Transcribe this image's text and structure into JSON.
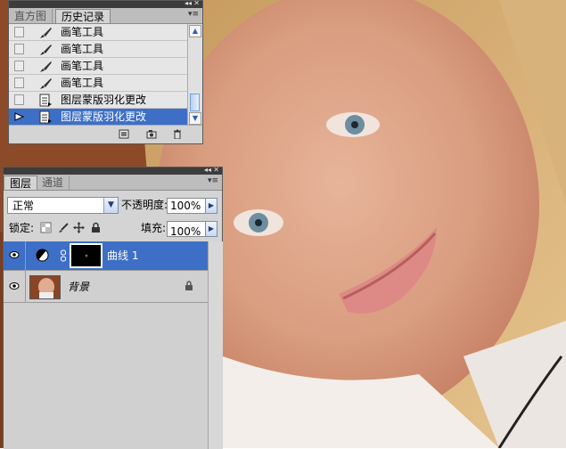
{
  "history_panel": {
    "tabs": [
      "直方图",
      "历史记录"
    ],
    "active_tab": "历史记录",
    "items": [
      {
        "label": "画笔工具",
        "icon": "brush-icon",
        "selected": false
      },
      {
        "label": "画笔工具",
        "icon": "brush-icon",
        "selected": false
      },
      {
        "label": "画笔工具",
        "icon": "brush-icon",
        "selected": false
      },
      {
        "label": "画笔工具",
        "icon": "brush-icon",
        "selected": false
      },
      {
        "label": "图层蒙版羽化更改",
        "icon": "document-icon",
        "selected": false
      },
      {
        "label": "图层蒙版羽化更改",
        "icon": "document-icon",
        "selected": true
      }
    ],
    "footer_icons": [
      "new-document-from-state-icon",
      "camera-snapshot-icon",
      "trash-icon"
    ]
  },
  "layers_panel": {
    "tabs": [
      "图层",
      "通道"
    ],
    "active_tab": "图层",
    "blend_mode": "正常",
    "opacity_label": "不透明度:",
    "opacity_value": "100%",
    "lock_label": "锁定:",
    "fill_label": "填充:",
    "fill_value": "100%",
    "layers": [
      {
        "name": "曲线 1",
        "visible": true,
        "selected": true,
        "type": "adjustment-curves"
      },
      {
        "name": "背景",
        "visible": true,
        "selected": false,
        "type": "background",
        "locked": true
      }
    ]
  },
  "colors": {
    "selection": "#3d6fc6",
    "panel_bg": "#d4d4d4",
    "titlebar": "#3c3c3c"
  }
}
